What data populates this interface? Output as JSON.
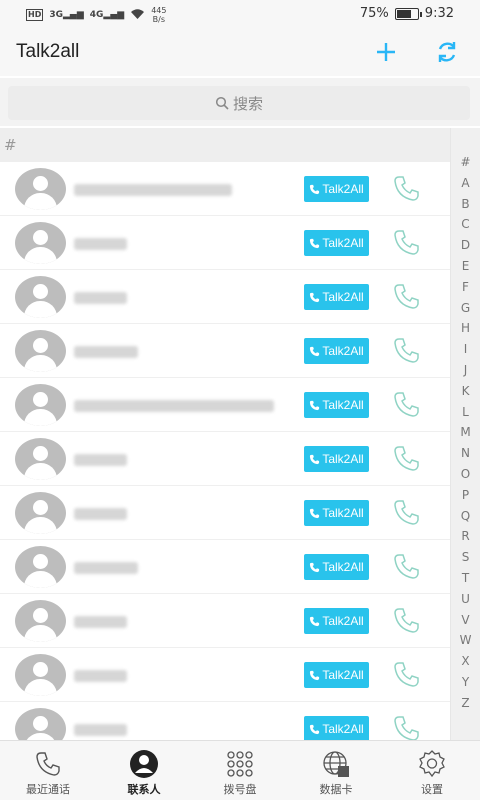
{
  "status_bar": {
    "hd": "HD",
    "sig1": "3G",
    "sig2": "4G",
    "speed_value": "445",
    "speed_unit": "B/s",
    "battery": "75%",
    "battery_level": 0.75,
    "time": "9:32"
  },
  "header": {
    "title": "Talk2all"
  },
  "search": {
    "placeholder": "搜索"
  },
  "section": {
    "header": "#"
  },
  "contacts": {
    "button_label": "Talk2All",
    "items": [
      {
        "name_width_fraction": 0.71
      },
      {
        "name_width_fraction": 0.24
      },
      {
        "name_width_fraction": 0.24
      },
      {
        "name_width_fraction": 0.29
      },
      {
        "name_width_fraction": 0.9
      },
      {
        "name_width_fraction": 0.24
      },
      {
        "name_width_fraction": 0.24
      },
      {
        "name_width_fraction": 0.29
      },
      {
        "name_width_fraction": 0.24
      },
      {
        "name_width_fraction": 0.24
      },
      {
        "name_width_fraction": 0.24
      }
    ]
  },
  "index": [
    "#",
    "A",
    "B",
    "C",
    "D",
    "E",
    "F",
    "G",
    "H",
    "I",
    "J",
    "K",
    "L",
    "M",
    "N",
    "O",
    "P",
    "Q",
    "R",
    "S",
    "T",
    "U",
    "V",
    "W",
    "X",
    "Y",
    "Z"
  ],
  "nav": {
    "recent": "最近通话",
    "contacts": "联系人",
    "dialpad": "拨号盘",
    "datacard": "数据卡",
    "settings": "设置"
  },
  "colors": {
    "accent": "#29b6f6",
    "talk2all_button": "#29c3ec",
    "call_icon": "#8fd3c4"
  }
}
